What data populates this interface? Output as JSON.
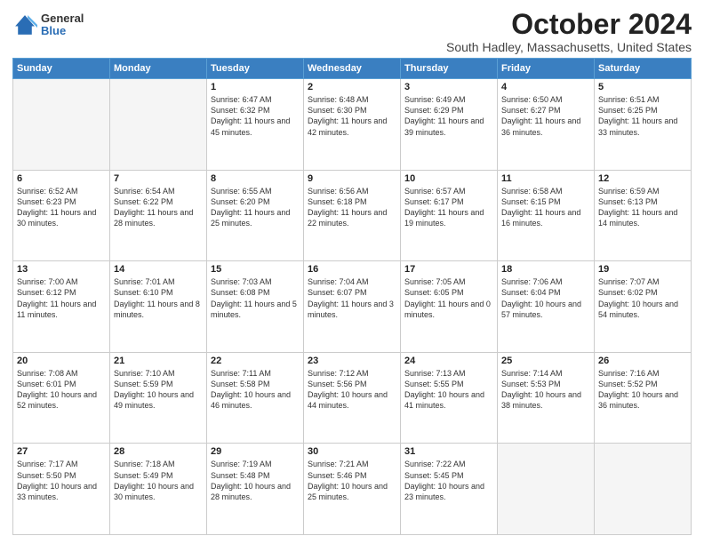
{
  "header": {
    "title": "October 2024",
    "subtitle": "South Hadley, Massachusetts, United States",
    "logo_line1": "General",
    "logo_line2": "Blue"
  },
  "weekdays": [
    "Sunday",
    "Monday",
    "Tuesday",
    "Wednesday",
    "Thursday",
    "Friday",
    "Saturday"
  ],
  "weeks": [
    [
      {
        "day": "",
        "info": ""
      },
      {
        "day": "",
        "info": ""
      },
      {
        "day": "1",
        "info": "Sunrise: 6:47 AM\nSunset: 6:32 PM\nDaylight: 11 hours and 45 minutes."
      },
      {
        "day": "2",
        "info": "Sunrise: 6:48 AM\nSunset: 6:30 PM\nDaylight: 11 hours and 42 minutes."
      },
      {
        "day": "3",
        "info": "Sunrise: 6:49 AM\nSunset: 6:29 PM\nDaylight: 11 hours and 39 minutes."
      },
      {
        "day": "4",
        "info": "Sunrise: 6:50 AM\nSunset: 6:27 PM\nDaylight: 11 hours and 36 minutes."
      },
      {
        "day": "5",
        "info": "Sunrise: 6:51 AM\nSunset: 6:25 PM\nDaylight: 11 hours and 33 minutes."
      }
    ],
    [
      {
        "day": "6",
        "info": "Sunrise: 6:52 AM\nSunset: 6:23 PM\nDaylight: 11 hours and 30 minutes."
      },
      {
        "day": "7",
        "info": "Sunrise: 6:54 AM\nSunset: 6:22 PM\nDaylight: 11 hours and 28 minutes."
      },
      {
        "day": "8",
        "info": "Sunrise: 6:55 AM\nSunset: 6:20 PM\nDaylight: 11 hours and 25 minutes."
      },
      {
        "day": "9",
        "info": "Sunrise: 6:56 AM\nSunset: 6:18 PM\nDaylight: 11 hours and 22 minutes."
      },
      {
        "day": "10",
        "info": "Sunrise: 6:57 AM\nSunset: 6:17 PM\nDaylight: 11 hours and 19 minutes."
      },
      {
        "day": "11",
        "info": "Sunrise: 6:58 AM\nSunset: 6:15 PM\nDaylight: 11 hours and 16 minutes."
      },
      {
        "day": "12",
        "info": "Sunrise: 6:59 AM\nSunset: 6:13 PM\nDaylight: 11 hours and 14 minutes."
      }
    ],
    [
      {
        "day": "13",
        "info": "Sunrise: 7:00 AM\nSunset: 6:12 PM\nDaylight: 11 hours and 11 minutes."
      },
      {
        "day": "14",
        "info": "Sunrise: 7:01 AM\nSunset: 6:10 PM\nDaylight: 11 hours and 8 minutes."
      },
      {
        "day": "15",
        "info": "Sunrise: 7:03 AM\nSunset: 6:08 PM\nDaylight: 11 hours and 5 minutes."
      },
      {
        "day": "16",
        "info": "Sunrise: 7:04 AM\nSunset: 6:07 PM\nDaylight: 11 hours and 3 minutes."
      },
      {
        "day": "17",
        "info": "Sunrise: 7:05 AM\nSunset: 6:05 PM\nDaylight: 11 hours and 0 minutes."
      },
      {
        "day": "18",
        "info": "Sunrise: 7:06 AM\nSunset: 6:04 PM\nDaylight: 10 hours and 57 minutes."
      },
      {
        "day": "19",
        "info": "Sunrise: 7:07 AM\nSunset: 6:02 PM\nDaylight: 10 hours and 54 minutes."
      }
    ],
    [
      {
        "day": "20",
        "info": "Sunrise: 7:08 AM\nSunset: 6:01 PM\nDaylight: 10 hours and 52 minutes."
      },
      {
        "day": "21",
        "info": "Sunrise: 7:10 AM\nSunset: 5:59 PM\nDaylight: 10 hours and 49 minutes."
      },
      {
        "day": "22",
        "info": "Sunrise: 7:11 AM\nSunset: 5:58 PM\nDaylight: 10 hours and 46 minutes."
      },
      {
        "day": "23",
        "info": "Sunrise: 7:12 AM\nSunset: 5:56 PM\nDaylight: 10 hours and 44 minutes."
      },
      {
        "day": "24",
        "info": "Sunrise: 7:13 AM\nSunset: 5:55 PM\nDaylight: 10 hours and 41 minutes."
      },
      {
        "day": "25",
        "info": "Sunrise: 7:14 AM\nSunset: 5:53 PM\nDaylight: 10 hours and 38 minutes."
      },
      {
        "day": "26",
        "info": "Sunrise: 7:16 AM\nSunset: 5:52 PM\nDaylight: 10 hours and 36 minutes."
      }
    ],
    [
      {
        "day": "27",
        "info": "Sunrise: 7:17 AM\nSunset: 5:50 PM\nDaylight: 10 hours and 33 minutes."
      },
      {
        "day": "28",
        "info": "Sunrise: 7:18 AM\nSunset: 5:49 PM\nDaylight: 10 hours and 30 minutes."
      },
      {
        "day": "29",
        "info": "Sunrise: 7:19 AM\nSunset: 5:48 PM\nDaylight: 10 hours and 28 minutes."
      },
      {
        "day": "30",
        "info": "Sunrise: 7:21 AM\nSunset: 5:46 PM\nDaylight: 10 hours and 25 minutes."
      },
      {
        "day": "31",
        "info": "Sunrise: 7:22 AM\nSunset: 5:45 PM\nDaylight: 10 hours and 23 minutes."
      },
      {
        "day": "",
        "info": ""
      },
      {
        "day": "",
        "info": ""
      }
    ]
  ]
}
